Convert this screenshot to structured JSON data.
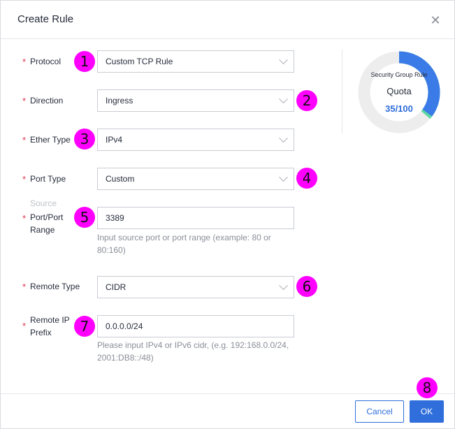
{
  "dialog": {
    "title": "Create Rule",
    "close_icon": "close-icon"
  },
  "form": {
    "required_mark": "*",
    "protocol": {
      "label": "Protocol",
      "value": "Custom TCP Rule"
    },
    "direction": {
      "label": "Direction",
      "value": "Ingress"
    },
    "ether_type": {
      "label": "Ether Type",
      "value": "IPv4"
    },
    "port_type": {
      "label": "Port Type",
      "value": "Custom"
    },
    "source_port": {
      "label_top": "Source",
      "label": "Port/Port Range",
      "value": "3389",
      "hint": "Input source port or port range (example: 80 or 80:160)"
    },
    "remote_type": {
      "label": "Remote Type",
      "value": "CIDR"
    },
    "remote_ip": {
      "label": "Remote IP Prefix",
      "value": "0.0.0.0/24",
      "hint": "Please input IPv4 or IPv6 cidr, (e.g. 192:168.0.0/24, 2001:DB8::/48)"
    }
  },
  "quota": {
    "label": "Security Group Rule",
    "title": "Quota",
    "value": "35/100",
    "used": 35,
    "total": 100,
    "colors": {
      "used": "#3b7be8",
      "accent": "#5cd6a0",
      "track": "#ededed"
    }
  },
  "footer": {
    "cancel_label": "Cancel",
    "ok_label": "OK"
  },
  "badges": [
    "1",
    "2",
    "3",
    "4",
    "5",
    "6",
    "7",
    "8"
  ]
}
